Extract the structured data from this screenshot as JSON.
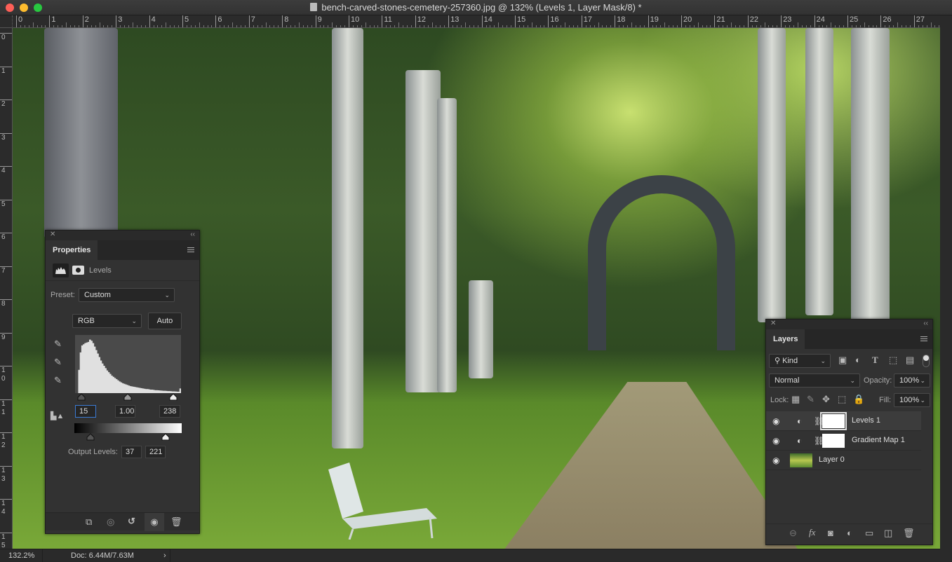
{
  "window": {
    "title": "bench-carved-stones-cemetery-257360.jpg @ 132% (Levels 1, Layer Mask/8) *",
    "traffic_colors": {
      "close": "#fe5f57",
      "minimize": "#febc2e",
      "maximize": "#28c840"
    }
  },
  "rulers": {
    "horizontal": [
      "0",
      "1",
      "2",
      "3",
      "4",
      "5",
      "6",
      "7",
      "8",
      "9",
      "10",
      "11",
      "12",
      "13",
      "14",
      "15",
      "16",
      "17",
      "18",
      "19",
      "20",
      "21",
      "22",
      "23",
      "24",
      "25",
      "26",
      "27"
    ],
    "vertical": [
      "0",
      "1",
      "2",
      "3",
      "4",
      "5",
      "6",
      "7",
      "8",
      "9",
      "1 0",
      "1 1",
      "1 2",
      "1 3",
      "1 4",
      "1 5"
    ]
  },
  "status": {
    "zoom": "132.2%",
    "doc": "Doc: 6.44M/7.63M",
    "arrow": "›"
  },
  "properties": {
    "tab": "Properties",
    "type_label": "Levels",
    "preset_label": "Preset:",
    "preset_value": "Custom",
    "channel": "RGB",
    "auto_label": "Auto",
    "input_black": "15",
    "input_gamma": "1.00",
    "input_white": "238",
    "output_label": "Output Levels:",
    "output_black": "37",
    "output_white": "221",
    "icons": [
      "clip-to-layer-icon",
      "view-previous-state-icon",
      "reset-icon",
      "visibility-eye-icon",
      "trash-icon"
    ]
  },
  "histogram": [
    0,
    0,
    40,
    70,
    82,
    84,
    86,
    87,
    88,
    92,
    90,
    86,
    80,
    74,
    68,
    62,
    56,
    51,
    47,
    43,
    39,
    36,
    33,
    30,
    28,
    26,
    24,
    22,
    20,
    18.5,
    17,
    16,
    15,
    14,
    13,
    12,
    11.5,
    11,
    10.5,
    10,
    9.5,
    9,
    8.5,
    8,
    7.5,
    7,
    7,
    6.5,
    6,
    6,
    5.5,
    5,
    5,
    4.8,
    4.5,
    4.3,
    4,
    4,
    3.8,
    3.5,
    3.5,
    3.3,
    3,
    3,
    2.8,
    2.5,
    2.5,
    8
  ],
  "layers": {
    "tab": "Layers",
    "filter": "Kind",
    "blend_mode": "Normal",
    "opacity_label": "Opacity:",
    "opacity": "100%",
    "lock_label": "Lock:",
    "fill_label": "Fill:",
    "fill": "100%",
    "items": [
      {
        "name": "Levels 1",
        "selected": true,
        "type": "adjustment"
      },
      {
        "name": "Gradient Map 1",
        "selected": false,
        "type": "adjustment"
      },
      {
        "name": "Layer 0",
        "selected": false,
        "type": "image"
      }
    ],
    "footer_icons": [
      "link-icon",
      "fx-icon",
      "add-mask-icon",
      "adjustment-icon",
      "folder-icon",
      "new-layer-icon",
      "trash-icon"
    ]
  }
}
